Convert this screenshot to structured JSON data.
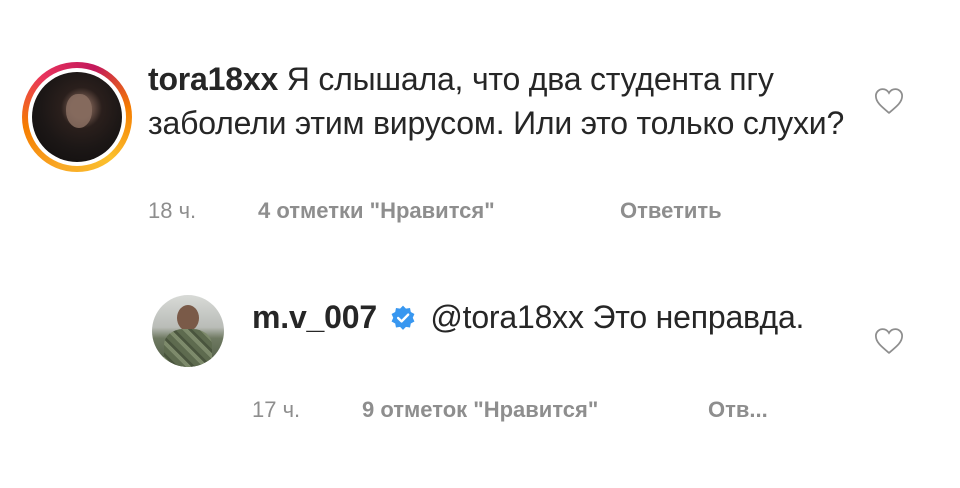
{
  "comments": [
    {
      "username": "tora18xx",
      "text": "Я слышала, что два студента пгу заболели этим вирусом. Или это только слухи?",
      "time": "18 ч.",
      "likes": "4 отметки \"Нравится\"",
      "reply": "Ответить",
      "avatar_icon": "user-avatar-photo",
      "has_story_ring": true
    },
    {
      "username": "m.v_007",
      "verified": true,
      "mention": "@tora18xx",
      "text": "Это неправда.",
      "time": "17 ч.",
      "likes": "9 отметок \"Нравится\"",
      "reply": "Отв...",
      "avatar_icon": "user-avatar-photo"
    }
  ],
  "colors": {
    "text": "#262626",
    "meta": "#8e8e8e",
    "verified_badge": "#3897f0",
    "heart_outline": "#8e8e8e"
  }
}
